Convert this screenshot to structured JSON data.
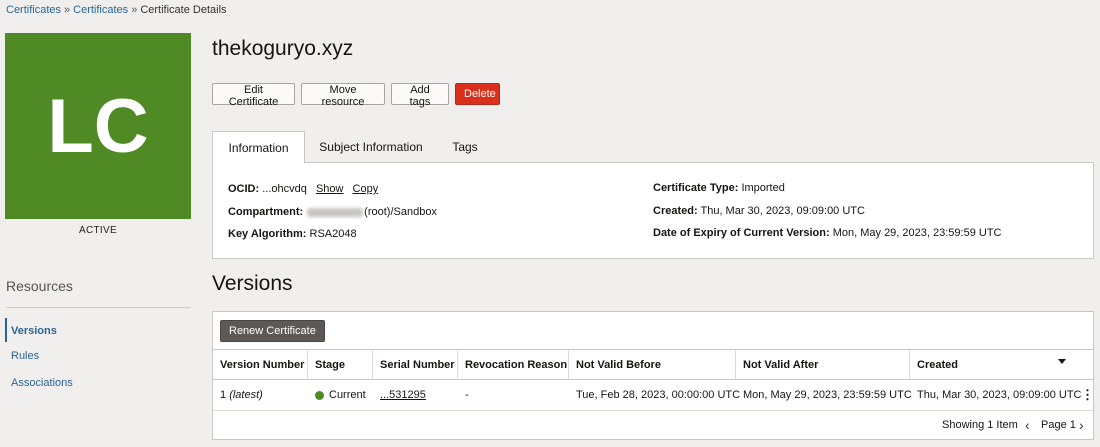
{
  "breadcrumb": {
    "items": [
      "Certificates",
      "Certificates"
    ],
    "current": "Certificate Details",
    "separator": "»"
  },
  "avatar": {
    "initials": "LC",
    "color": "#4f8a25"
  },
  "status": {
    "text": "ACTIVE"
  },
  "resources": {
    "title": "Resources",
    "items": [
      {
        "label": "Versions",
        "active": true
      },
      {
        "label": "Rules"
      },
      {
        "label": "Associations"
      }
    ]
  },
  "title": "thekoguryo.xyz",
  "actions": {
    "edit": "Edit Certificate",
    "move": "Move resource",
    "tags": "Add tags",
    "delete": "Delete"
  },
  "tabs": [
    {
      "label": "Information",
      "active": true
    },
    {
      "label": "Subject Information"
    },
    {
      "label": "Tags"
    }
  ],
  "info": {
    "ocid_label": "OCID:",
    "ocid_value": "...ohcvdq",
    "show_link": "Show",
    "copy_link": "Copy",
    "compartment_label": "Compartment:",
    "compartment_value": "(root)/Sandbox",
    "key_algorithm_label": "Key Algorithm:",
    "key_algorithm_value": "RSA2048",
    "cert_type_label": "Certificate Type:",
    "cert_type_value": "Imported",
    "created_label": "Created:",
    "created_value": "Thu, Mar 30, 2023, 09:09:00 UTC",
    "expiry_label": "Date of Expiry of Current Version:",
    "expiry_value": "Mon, May 29, 2023, 23:59:59 UTC"
  },
  "versions": {
    "title": "Versions",
    "renew_button": "Renew Certificate",
    "columns": [
      "Version Number",
      "Stage",
      "Serial Number",
      "Revocation Reason",
      "Not Valid Before",
      "Not Valid After",
      "Created"
    ],
    "rows": [
      {
        "version": "1",
        "version_note": "(latest)",
        "stage": "Current",
        "stage_color": "#4f8a25",
        "serial": "...531295",
        "revocation": "-",
        "not_before": "Tue, Feb 28, 2023, 00:00:00 UTC",
        "not_after": "Mon, May 29, 2023, 23:59:59 UTC",
        "created": "Thu, Mar 30, 2023, 09:09:00 UTC"
      }
    ],
    "footer_showing": "Showing 1 Item",
    "footer_page": "Page 1"
  },
  "icons": {
    "sort": "caret-down-icon",
    "row_menu": "kebab-icon",
    "prev": "chevron-left-icon",
    "next": "chevron-right-icon"
  }
}
